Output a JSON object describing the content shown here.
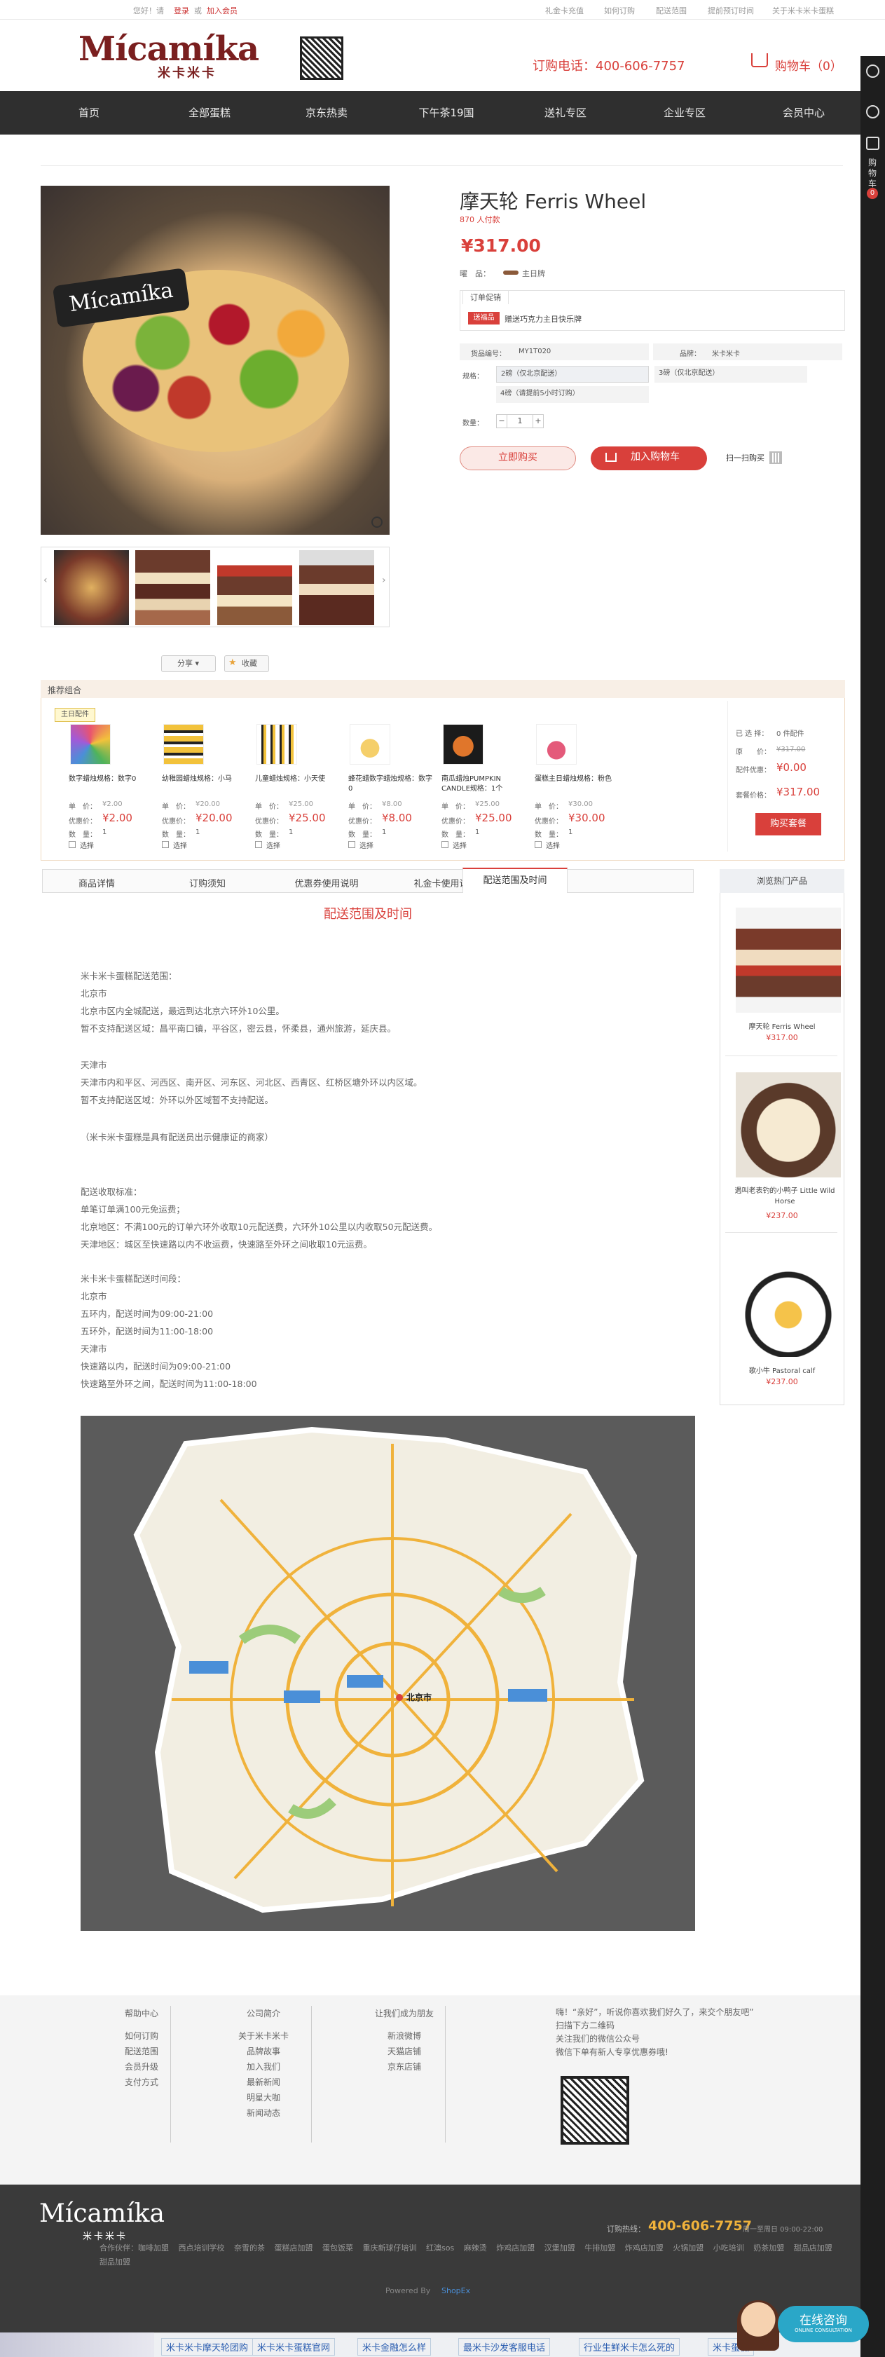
{
  "topbar": {
    "greeting": "您好！请",
    "login": "登录",
    "or": "或",
    "register": "加入会员",
    "links": [
      "礼金卡充值",
      "如何订购",
      "配送范围",
      "提前预订时间",
      "关于米卡米卡蛋糕"
    ]
  },
  "header": {
    "logo_text": "Mícamíka",
    "logo_sub": "米卡米卡",
    "phone": "订购电话：400-606-7757",
    "cart": "购物车（0）"
  },
  "nav": [
    "首页",
    "全部蛋糕",
    "京东热卖",
    "下午茶19国",
    "送礼专区",
    "企业专区",
    "会员中心"
  ],
  "rightbar": {
    "cart_label": "购物车",
    "cart_count": "0"
  },
  "product": {
    "title": "摩天轮 Ferris Wheel",
    "sold": "870 人付款",
    "price": "¥317.00",
    "tag_label": "曜　品：",
    "tag_value": "主日牌",
    "promo_tab": "订单促销",
    "promo_badge": "送福品",
    "promo_text": "赠送巧克力主日快乐牌",
    "sku_label": "货品编号：",
    "sku_value": "MY1T020",
    "brand_label": "品牌：",
    "brand_value": "米卡米卡",
    "spec_label": "规格：",
    "specs": [
      "2磅（仅北京配送）",
      "3磅（仅北京配送）",
      "4磅（请提前5小时订购）"
    ],
    "qty_label": "数量：",
    "qty_value": "1",
    "buy_now": "立即购买",
    "add_cart": "加入购物车",
    "scan": "扫一扫购买",
    "share": "分享",
    "fav": "收藏"
  },
  "combo": {
    "title": "推荐组合",
    "main_tag": "主日配件",
    "items": [
      {
        "name": "数字蜡烛规格：数字0",
        "unit_label": "单　价：",
        "unit": "¥2.00",
        "offer_label": "优惠价：",
        "offer": "¥2.00",
        "qty_label": "数　量：",
        "qty": "1",
        "select": "选择"
      },
      {
        "name": "幼稚园蜡烛规格：小马",
        "unit_label": "单　价：",
        "unit": "¥20.00",
        "offer_label": "优惠价：",
        "offer": "¥20.00",
        "qty_label": "数　量：",
        "qty": "1",
        "select": "选择"
      },
      {
        "name": "儿童蜡烛规格：小天使",
        "unit_label": "单　价：",
        "unit": "¥25.00",
        "offer_label": "优惠价：",
        "offer": "¥25.00",
        "qty_label": "数　量：",
        "qty": "1",
        "select": "选择"
      },
      {
        "name": "蜂花蜡数字蜡烛规格：数字0",
        "unit_label": "单　价：",
        "unit": "¥8.00",
        "offer_label": "优惠价：",
        "offer": "¥8.00",
        "qty_label": "数　量：",
        "qty": "1",
        "select": "选择"
      },
      {
        "name": "南瓜蜡烛PUMPKIN CANDLE规格：1个",
        "unit_label": "单　价：",
        "unit": "¥25.00",
        "offer_label": "优惠价：",
        "offer": "¥25.00",
        "qty_label": "数　量：",
        "qty": "1",
        "select": "选择"
      },
      {
        "name": "蛋糕主日蜡烛规格：粉色",
        "unit_label": "单　价：",
        "unit": "¥30.00",
        "offer_label": "优惠价：",
        "offer": "¥30.00",
        "qty_label": "数　量：",
        "qty": "1",
        "select": "选择"
      }
    ],
    "summary": {
      "selected_label": "已 选 择：",
      "selected": "0 件配件",
      "orig_label": "原　　价：",
      "orig": "¥317.00",
      "discount_label": "配件优惠：",
      "discount": "¥0.00",
      "set_label": "套餐价格：",
      "set": "¥317.00",
      "buy": "购买套餐"
    }
  },
  "tabs": [
    "商品详情",
    "订购须知",
    "优惠券使用说明",
    "礼金卡使用说明",
    "配送范围及时间"
  ],
  "side": {
    "title": "浏览热门产品",
    "items": [
      {
        "name": "摩天轮 Ferris Wheel",
        "price": "¥317.00"
      },
      {
        "name": "遇叫老表钓的小鸭子 Little Wild Horse",
        "price": "¥237.00"
      },
      {
        "name": "歌小牛 Pastoral calf",
        "price": "¥237.00"
      }
    ]
  },
  "delivery": {
    "heading": "配送范围及时间",
    "p1": [
      "米卡米卡蛋糕配送范围：",
      "北京市",
      "北京市区内全城配送，最远到达北京六环外10公里。",
      "暂不支持配送区域：昌平南口镇，平谷区，密云县，怀柔县，通州旅游，延庆县。"
    ],
    "p2": [
      "天津市",
      "天津市内和平区、河西区、南开区、河东区、河北区、西青区、红桥区塘外环以内区域。",
      "暂不支持配送区域：外环以外区域暂不支持配送。"
    ],
    "p3": [
      "（米卡米卡蛋糕是具有配送员出示健康证的商家）"
    ],
    "p4": [
      "配送收取标准：",
      "单笔订单满100元免运费；",
      "北京地区：不满100元的订单六环外收取10元配送费，六环外10公里以内收取50元配送费。",
      "天津地区：城区至快速路以内不收运费，快速路至外环之间收取10元运费。"
    ],
    "p5": [
      "米卡米卡蛋糕配送时间段：",
      "北京市",
      "五环内，配送时间为09:00-21:00",
      "五环外，配送时间为11:00-18:00",
      "天津市",
      "快速路以内，配送时间为09:00-21:00",
      "快速路至外环之间，配送时间为11:00-18:00"
    ],
    "map_center": "北京市"
  },
  "footer": {
    "col1_title": "帮助中心",
    "col1": [
      "如何订购",
      "配送范围",
      "会员升级",
      "支付方式"
    ],
    "col2_title": "公司简介",
    "col2": [
      "关于米卡米卡",
      "品牌故事",
      "加入我们",
      "最新新闻",
      "明星大咖",
      "新闻动态"
    ],
    "col3_title": "让我们成为朋友",
    "col3": [
      "新浪微博",
      "天猫店铺",
      "京东店铺"
    ],
    "wechat_lines": [
      "嗨！“亲好”，听说你喜欢我们好久了，来交个朋友吧”",
      "扫描下方二维码",
      "关注我们的微信公众号",
      "微信下单有新人专享优惠券哦!"
    ],
    "hotline_label": "订购热线：",
    "hotline": "400-606-7757",
    "hotline_note": "周一至周日 09:00-22:00",
    "links": [
      "合作伙伴：咖啡加盟",
      "西点培训学校",
      "奈雪的茶",
      "蛋糕店加盟",
      "蛋包饭菜",
      "重庆新球仔培训",
      "红澳sos",
      "麻辣烫",
      "炸鸡店加盟",
      "汉堡加盟",
      "牛排加盟",
      "炸鸡店加盟",
      "火锅加盟",
      "小吃培训",
      "奶茶加盟",
      "甜品店加盟",
      "甜品加盟"
    ],
    "powered": "Powered By",
    "powered_brand": "ShopEx",
    "bottom_links": [
      "米卡米卡摩天轮团购",
      "米卡米卡蛋糕官网",
      "米卡金融怎么样",
      "最米卡沙发客服电话",
      "行业生鲜米卡怎么死的",
      "米卡蛋糕"
    ],
    "consult": "在线咨询",
    "consult_en": "ONLINE CONSULTATION"
  }
}
